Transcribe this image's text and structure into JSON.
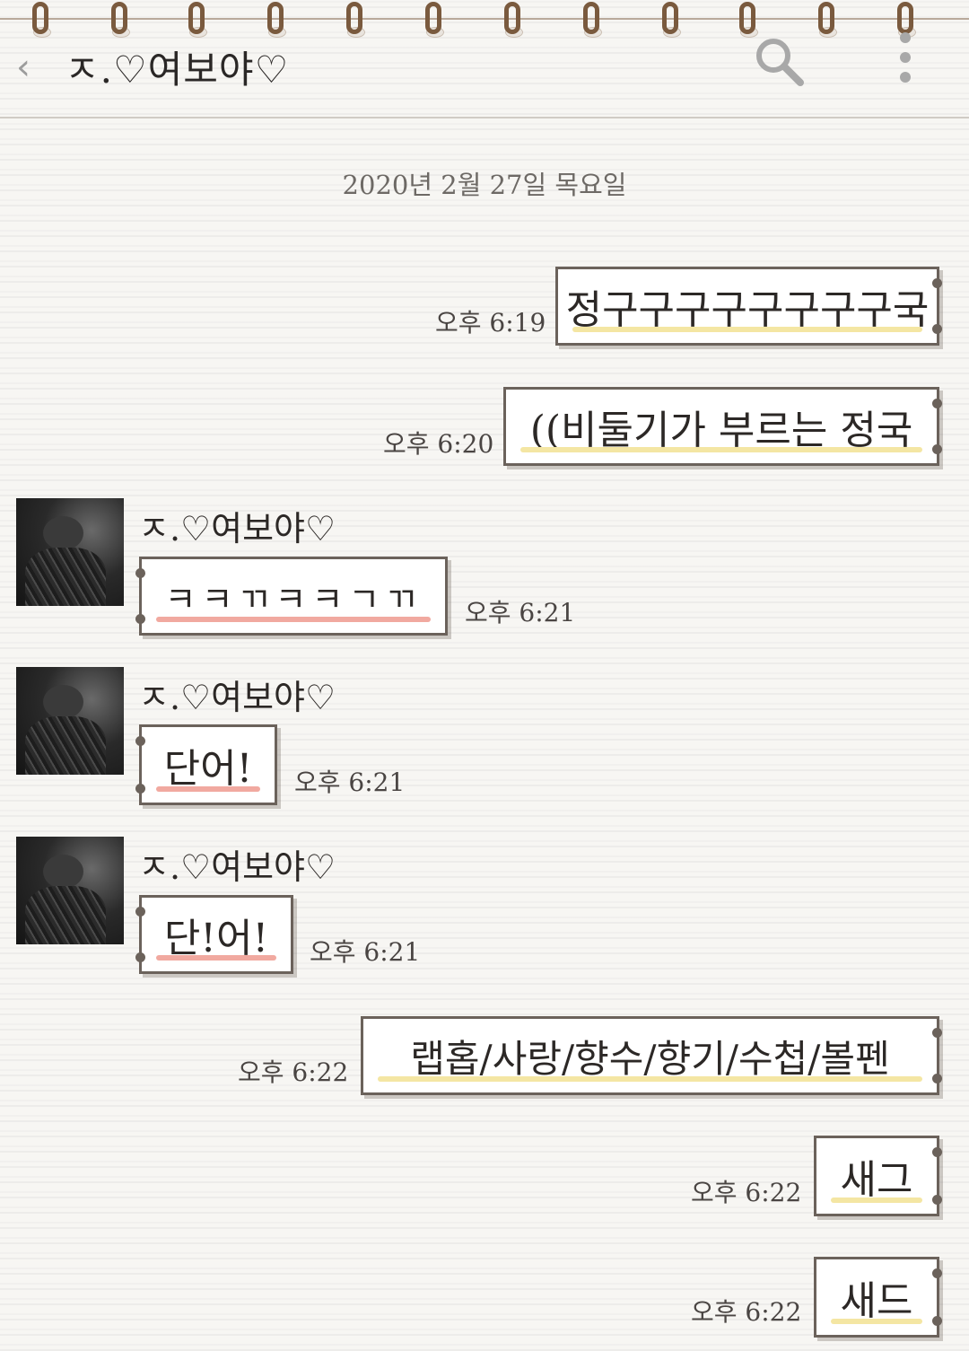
{
  "header": {
    "title": "ㅈ.♡여보야♡"
  },
  "date_divider": "2020년 2월 27일 목요일",
  "messages": [
    {
      "side": "mine",
      "text": "정구구구구구구구구국",
      "time": "오후 6:19"
    },
    {
      "side": "mine",
      "text": "((비둘기가 부르는 정국",
      "time": "오후 6:20"
    },
    {
      "side": "theirs",
      "sender": "ㅈ.♡여보야♡",
      "text": "ㅋㅋㄲㅋㅋㄱㄲ",
      "time": "오후 6:21"
    },
    {
      "side": "theirs",
      "sender": "ㅈ.♡여보야♡",
      "text": "단어!",
      "time": "오후 6:21"
    },
    {
      "side": "theirs",
      "sender": "ㅈ.♡여보야♡",
      "text": "단!어!",
      "time": "오후 6:21"
    },
    {
      "side": "mine",
      "text": "랩홉/사랑/향수/향기/수첩/볼펜",
      "time": "오후 6:22"
    },
    {
      "side": "mine",
      "text": "새그",
      "time": "오후 6:22"
    },
    {
      "side": "mine",
      "text": "새드",
      "time": "오후 6:22"
    }
  ],
  "colors": {
    "background": "#f7f6f3",
    "bubble_border": "#6b625b",
    "mine_highlight": "#f4e6a3",
    "theirs_highlight": "#f1a9a0",
    "ring": "#7a5a3e"
  },
  "icons": {
    "back": "chevron-left-icon",
    "search": "search-icon",
    "menu": "kebab-menu-icon"
  }
}
